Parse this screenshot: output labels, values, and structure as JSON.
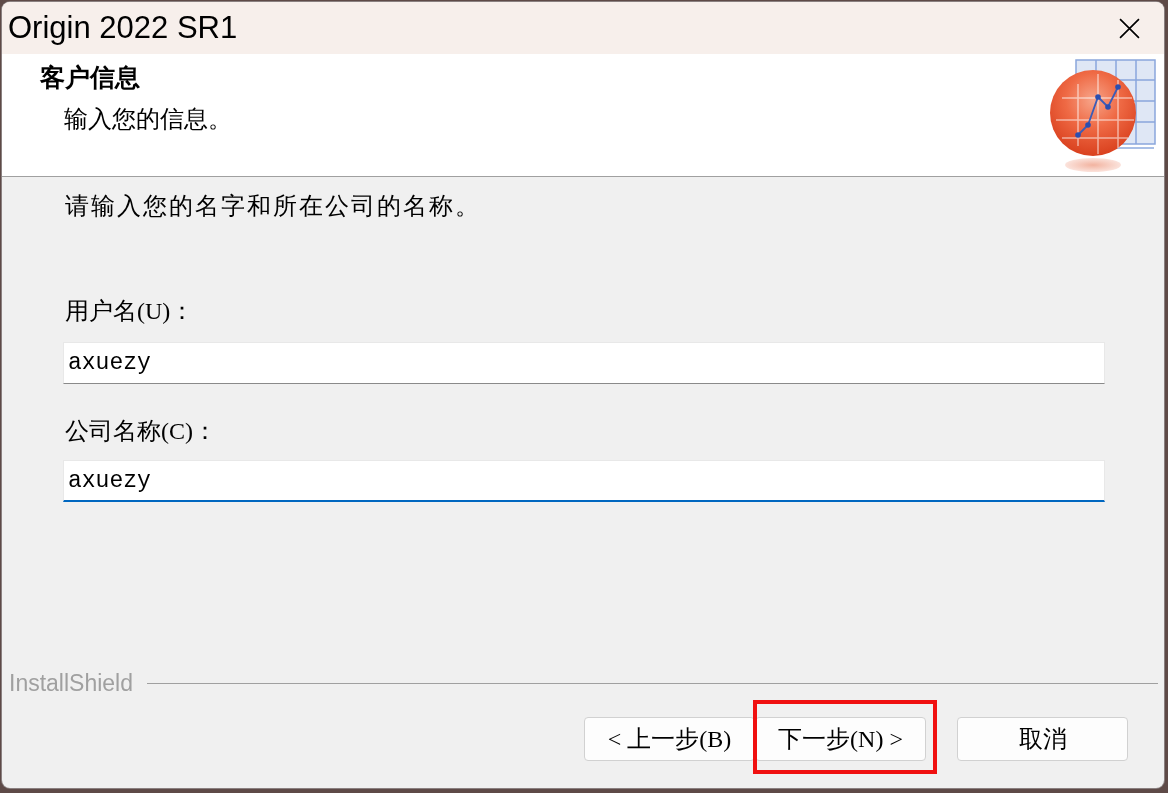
{
  "window": {
    "title": "Origin 2022 SR1"
  },
  "header": {
    "title": "客户信息",
    "subtitle": "输入您的信息。"
  },
  "instruction": "请输入您的名字和所在公司的名称。",
  "fields": [
    {
      "label": "用户名(U)：",
      "value": "axuezy",
      "focused": false
    },
    {
      "label": "公司名称(C)：",
      "value": "axuezy",
      "focused": true
    }
  ],
  "footer": {
    "brand": "InstallShield"
  },
  "buttons": [
    {
      "label": "< 上一步(B)",
      "highlighted": false
    },
    {
      "label": "下一步(N) >",
      "highlighted": true
    },
    {
      "label": "取消",
      "highlighted": false
    }
  ]
}
